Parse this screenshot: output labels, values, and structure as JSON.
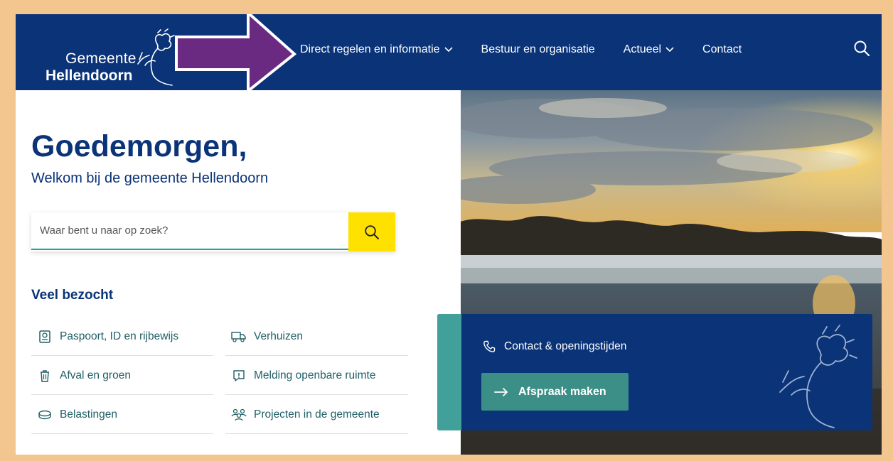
{
  "header": {
    "logo": {
      "line1": "Gemeente",
      "line2": "Hellendoorn"
    },
    "nav": [
      {
        "label": "Direct regelen en informatie",
        "has_dropdown": true
      },
      {
        "label": "Bestuur en organisatie",
        "has_dropdown": false
      },
      {
        "label": "Actueel",
        "has_dropdown": true
      },
      {
        "label": "Contact",
        "has_dropdown": false
      }
    ],
    "search_icon": "search-icon"
  },
  "hero": {
    "greeting": "Goedemorgen,",
    "welcome": "Welkom bij de gemeente Hellendoorn"
  },
  "search": {
    "placeholder": "Waar bent u naar op zoek?",
    "button_icon": "search-icon"
  },
  "veel_bezocht": {
    "heading": "Veel bezocht",
    "items": [
      {
        "label": "Paspoort, ID en rijbewijs",
        "icon": "passport-icon"
      },
      {
        "label": "Verhuizen",
        "icon": "truck-icon"
      },
      {
        "label": "Afval en groen",
        "icon": "trash-icon"
      },
      {
        "label": "Melding openbare ruimte",
        "icon": "alert-message-icon"
      },
      {
        "label": "Belastingen",
        "icon": "coins-icon"
      },
      {
        "label": "Projecten in de gemeente",
        "icon": "people-icon"
      }
    ]
  },
  "contact_card": {
    "contact_label": "Contact & openingstijden",
    "appointment_label": "Afspraak maken"
  },
  "colors": {
    "navy": "#0a3378",
    "teal": "#41a09a",
    "button_teal": "#3b8f86",
    "search_yellow": "#ffe100",
    "annotation_arrow": "#6a2a82",
    "border": "#f3c58f"
  }
}
